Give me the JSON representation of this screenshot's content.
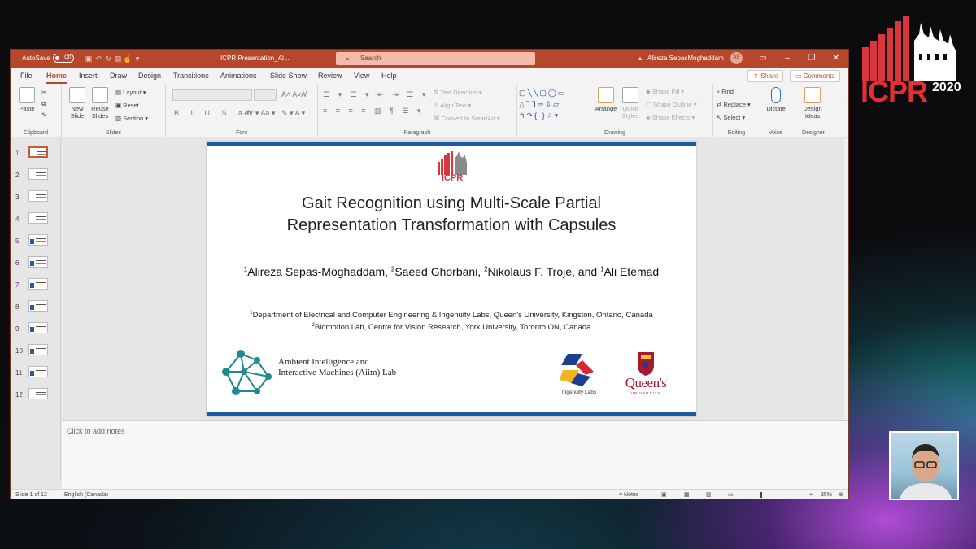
{
  "overlay": {
    "icpr_logo_text": "ICPR",
    "icpr_logo_year": "2020"
  },
  "window": {
    "autosave_label": "AutoSave",
    "autosave_state": "Off",
    "doc_title": "ICPR Presentation_Al...",
    "search_placeholder": "Search",
    "user_name": "Alireza SepasMoghaddam",
    "user_initials": "AS",
    "accent_color": "#b7472a"
  },
  "menu": {
    "tabs": [
      "File",
      "Home",
      "Insert",
      "Draw",
      "Design",
      "Transitions",
      "Animations",
      "Slide Show",
      "Review",
      "View",
      "Help"
    ],
    "share_label": "Share",
    "comments_label": "Comments"
  },
  "ribbon": {
    "clipboard": {
      "paste": "Paste",
      "group": "Clipboard"
    },
    "slides": {
      "new_slide": "New Slide",
      "reuse_slides": "Reuse Slides",
      "layout": "Layout",
      "reset": "Reset",
      "section": "Section",
      "group": "Slides"
    },
    "font": {
      "group": "Font"
    },
    "paragraph": {
      "text_direction": "Text Direction",
      "align_text": "Align Text",
      "convert_smartart": "Convert to SmartArt",
      "group": "Paragraph"
    },
    "drawing": {
      "arrange": "Arrange",
      "quick_styles": "Quick Styles",
      "shape_fill": "Shape Fill",
      "shape_outline": "Shape Outline",
      "shape_effects": "Shape Effects",
      "group": "Drawing"
    },
    "editing": {
      "find": "Find",
      "replace": "Replace",
      "select": "Select",
      "group": "Editing"
    },
    "voice": {
      "dictate": "Dictate",
      "group": "Voice"
    },
    "designer": {
      "design_ideas": "Design Ideas",
      "group": "Designer"
    }
  },
  "thumbnails": [
    "1",
    "2",
    "3",
    "4",
    "5",
    "6",
    "7",
    "8",
    "9",
    "10",
    "11",
    "12"
  ],
  "slide": {
    "logo_text": "ICPR",
    "title_line1": "Gait Recognition using Multi-Scale Partial",
    "title_line2": "Representation Transformation with Capsules",
    "authors": [
      {
        "sup": "1",
        "name": "Alireza Sepas-Moghaddam,"
      },
      {
        "sup": "2",
        "name": "Saeed Ghorbani,"
      },
      {
        "sup": "2",
        "name": "Nikolaus F. Troje, and"
      },
      {
        "sup": "1",
        "name": "Ali Etemad"
      }
    ],
    "affiliation1_sup": "1",
    "affiliation1": "Department of Electrical and Computer Engineering & Ingenuity Labs, Queen's University, Kingston, Ontario, Canada",
    "affiliation2_sup": "2",
    "affiliation2": "Biomotion Lab, Centre for Vision Research, York University, Toronto ON, Canada",
    "aiim_line1": "Ambient Intelligence and",
    "aiim_line2": "Interactive Machines (Aiim) Lab",
    "ingenuity_label": "Ingenuity Labs",
    "queens_name": "Queen's",
    "queens_sub": "UNIVERSITY"
  },
  "notes_placeholder": "Click to add notes",
  "status": {
    "slide_counter": "Slide 1 of 12",
    "language": "English (Canada)",
    "notes_label": "Notes",
    "zoom": "35%"
  }
}
